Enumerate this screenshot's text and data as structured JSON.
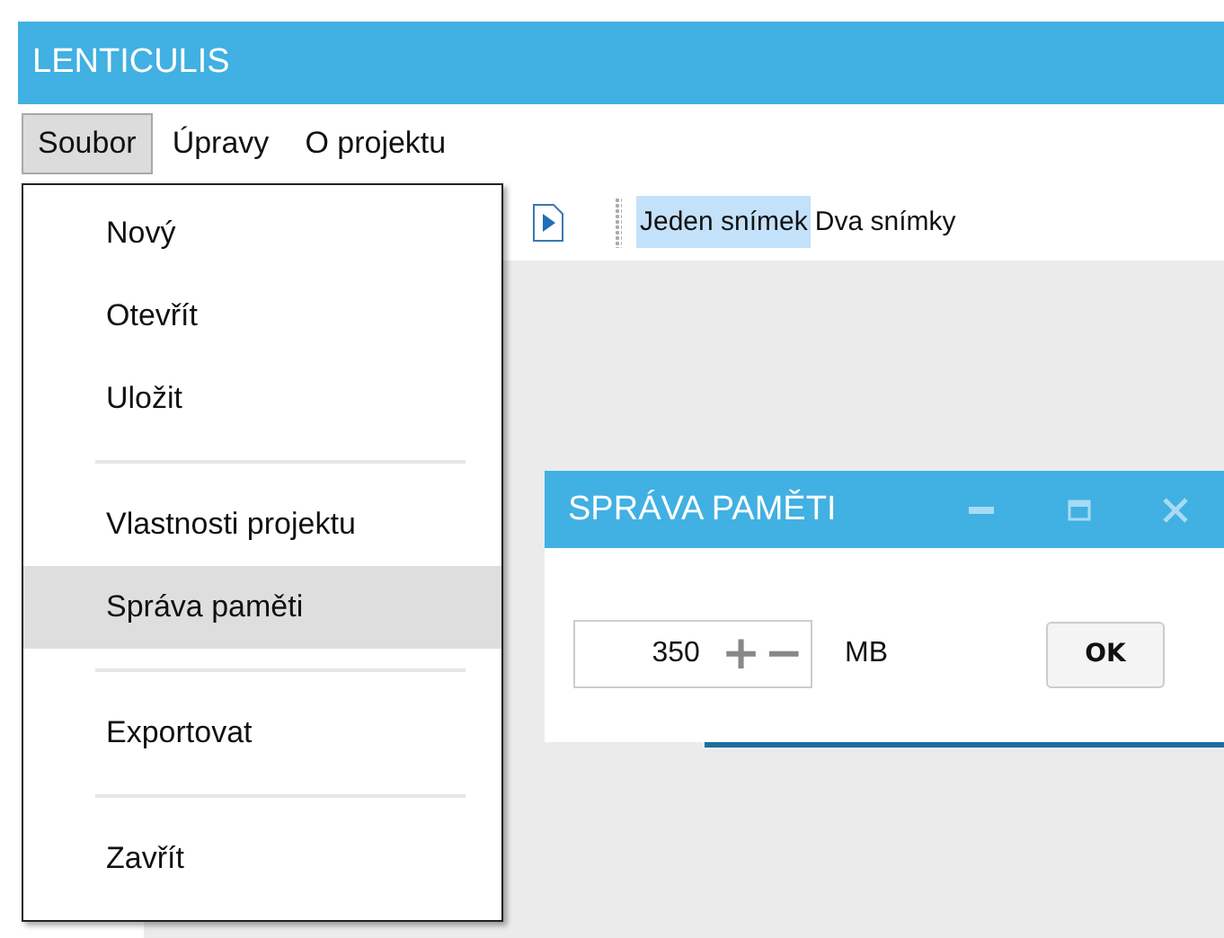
{
  "window": {
    "title": "LENTICULIS"
  },
  "menu_bar": [
    {
      "label": "Soubor",
      "selected": true
    },
    {
      "label": "Úpravy",
      "selected": false
    },
    {
      "label": "O projektu",
      "selected": false
    }
  ],
  "dropdown": [
    {
      "kind": "item",
      "label": "Nový",
      "selected": false
    },
    {
      "kind": "item",
      "label": "Otevřít",
      "selected": false
    },
    {
      "kind": "item",
      "label": "Uložit",
      "selected": false
    },
    {
      "kind": "separator"
    },
    {
      "kind": "item",
      "label": "Vlastnosti projektu",
      "selected": false
    },
    {
      "kind": "item",
      "label": "Správa paměti",
      "selected": true
    },
    {
      "kind": "separator"
    },
    {
      "kind": "item",
      "label": "Exportovat",
      "selected": false
    },
    {
      "kind": "separator"
    },
    {
      "kind": "item",
      "label": "Zavřít",
      "selected": false
    }
  ],
  "toolbar": {
    "view_buttons": [
      {
        "label": "Jeden snímek",
        "selected": true
      },
      {
        "label": "Dva snímky",
        "selected": false
      }
    ]
  },
  "dialog": {
    "title": "SPRÁVA PAMĚTI",
    "spinner": {
      "value": "350",
      "increment": "+",
      "decrement": "−"
    },
    "unit": "MB",
    "ok_button": "OK"
  }
}
